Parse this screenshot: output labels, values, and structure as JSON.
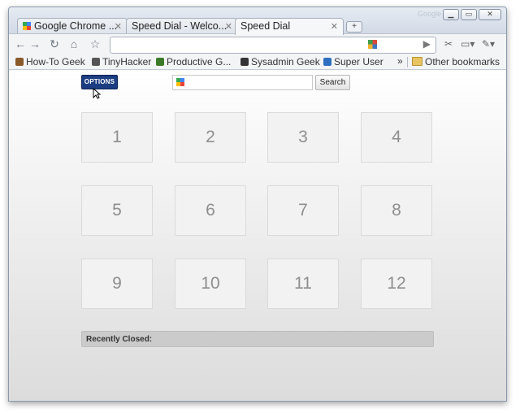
{
  "window": {
    "brand": "Google",
    "controls": [
      "minimize",
      "maximize",
      "close"
    ]
  },
  "tabs": [
    {
      "title": "Google Chrome ...",
      "active": false
    },
    {
      "title": "Speed Dial - Welco...",
      "active": false
    },
    {
      "title": "Speed Dial",
      "active": true
    }
  ],
  "toolbar": {
    "back_icon": "←",
    "forward_icon": "→",
    "reload_icon": "↻",
    "home_icon": "⌂",
    "star_icon": "☆",
    "play_icon": "▶",
    "page_menu_icon": "▭▾",
    "wrench_menu_icon": "✎▾"
  },
  "bookmarks": {
    "items": [
      {
        "label": "How-To Geek",
        "color": "#8a5a2b"
      },
      {
        "label": "TinyHacker",
        "color": "#555555"
      },
      {
        "label": "Productive G...",
        "color": "#3c7a2a"
      },
      {
        "label": "Sysadmin Geek",
        "color": "#333333"
      },
      {
        "label": "Super User",
        "color": "#2f6fbf"
      }
    ],
    "overflow": "»",
    "other": "Other bookmarks"
  },
  "page": {
    "options_label": "OPTIONS",
    "search_placeholder": "",
    "search_button": "Search",
    "dials": [
      "1",
      "2",
      "3",
      "4",
      "5",
      "6",
      "7",
      "8",
      "9",
      "10",
      "11",
      "12"
    ],
    "recently_closed": "Recently Closed:"
  }
}
